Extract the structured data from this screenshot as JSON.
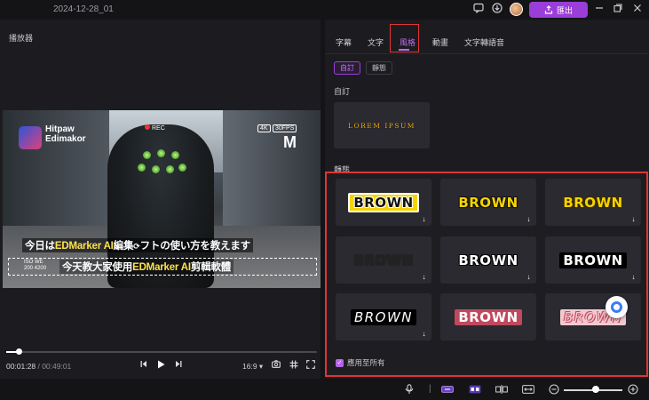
{
  "window": {
    "title": "2024-12-28_01",
    "export_label": "匯出"
  },
  "player": {
    "title": "播放器",
    "video": {
      "brand_line1": "Hitpaw",
      "brand_line2": "Edimakor",
      "rec": "REC",
      "badge_4k": "4K",
      "badge_fps": "30FPS",
      "badge_m": "M",
      "subtitle_jp_a": "今日は",
      "subtitle_jp_b": "EDMarker AI",
      "subtitle_jp_c": "編集",
      "subtitle_jp_d": "フトの使い方を教えます",
      "subtitle_zh_a": "今天教大家使用",
      "subtitle_zh_b": "EDMarker AI",
      "subtitle_zh_c": "剪輯軟體",
      "iso_line1": "ISO      WE",
      "iso_line2": "200   4200"
    },
    "progress_fraction": 0.04,
    "current_time": "00:01:28",
    "separator": " / ",
    "duration": "00:49:01",
    "aspect_ratio": "16:9"
  },
  "styles": {
    "tabs": [
      "字幕",
      "文字",
      "風格",
      "動畫",
      "文字轉語音"
    ],
    "active_tab": "風格",
    "subtabs": [
      "自訂",
      "靜態"
    ],
    "custom_label": "自訂",
    "custom_preset_text": "LOREM IPSUM",
    "static_label": "靜態",
    "presets": [
      {
        "text": "BROWN",
        "fg": "#111111",
        "bg": "#f5d400",
        "outline": "#ffffff"
      },
      {
        "text": "BROWN",
        "fg": "#f5d400",
        "bg": "",
        "outline": "#111111"
      },
      {
        "text": "BROWN",
        "fg": "#f5d400",
        "bg": "",
        "outline": "#3a2a00"
      },
      {
        "text": "BROWN",
        "fg": "gradient",
        "bg": "",
        "outline": "#222222"
      },
      {
        "text": "BROWN",
        "fg": "#ffffff",
        "bg": "",
        "outline": "#000000"
      },
      {
        "text": "BROWN",
        "fg": "#ffffff",
        "bg": "#000000",
        "outline": ""
      },
      {
        "text": "BROWN",
        "fg": "#ffffff",
        "bg": "#000000",
        "outline": "",
        "italic": true
      },
      {
        "text": "BROWN",
        "fg": "#ffffff",
        "bg": "#c0495e",
        "outline": ""
      },
      {
        "text": "BROWN",
        "fg": "#f3c9d0",
        "bg": "#f3c9d0",
        "outline": "#c0495e",
        "italic": true
      }
    ],
    "apply_all_label": "應用至所有",
    "apply_all_checked": true
  },
  "colors": {
    "accent": "#9b3dd9",
    "highlight_outline": "#e03535"
  }
}
